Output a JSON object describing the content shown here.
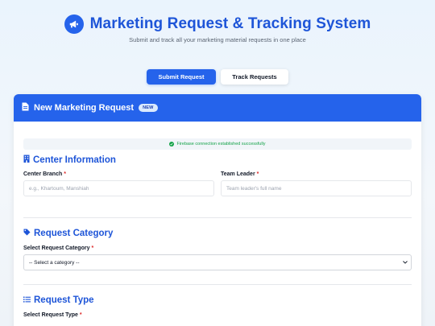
{
  "header": {
    "title": "Marketing Request & Tracking System",
    "subtitle": "Submit and track all your marketing material requests in one place"
  },
  "tabs": [
    {
      "label": "Submit Request",
      "active": true
    },
    {
      "label": "Track Requests",
      "active": false
    }
  ],
  "form": {
    "title": "New Marketing Request",
    "badge": "NEW",
    "status": "Firebase connection established successfully",
    "sections": {
      "center": {
        "title": "Center Information",
        "branch_label": "Center Branch",
        "branch_placeholder": "e.g., Khartoum, Manshiah",
        "leader_label": "Team Leader",
        "leader_placeholder": "Team leader's full name"
      },
      "category": {
        "title": "Request Category",
        "select_label": "Select Request Category",
        "select_value": "-- Select a category --"
      },
      "type": {
        "title": "Request Type",
        "select_label": "Select Request Type"
      }
    },
    "required_mark": "*"
  },
  "colors": {
    "primary": "#2563eb",
    "title": "#1e55d8",
    "success": "#16a34a",
    "required": "#dc2626"
  }
}
